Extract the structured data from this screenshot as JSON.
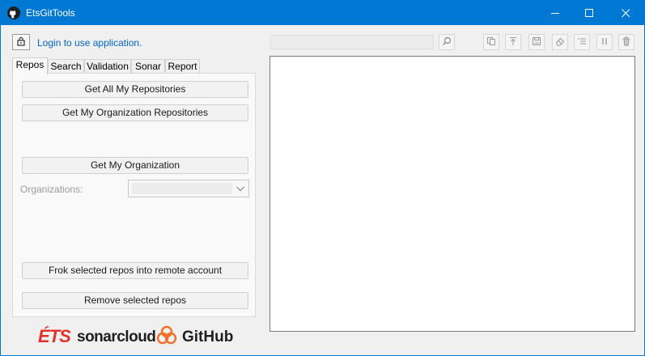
{
  "window": {
    "title": "EtsGitTools",
    "accent": "#0078d4"
  },
  "login": {
    "link_text": "Login to use application.",
    "icon": "lock-icon"
  },
  "tabs": [
    {
      "label": "Repos",
      "active": true
    },
    {
      "label": "Search",
      "active": false
    },
    {
      "label": "Validation",
      "active": false
    },
    {
      "label": "Sonar",
      "active": false
    },
    {
      "label": "Report",
      "active": false
    }
  ],
  "repos_tab": {
    "get_all_repos": "Get All My Repositories",
    "get_org_repos": "Get My Organization Repositories",
    "get_org": "Get My Organization",
    "organizations_label": "Organizations:",
    "organizations_value": "",
    "fork_repos": "Frok selected repos into remote account",
    "remove_repos": "Remove selected repos"
  },
  "logos": {
    "ets": "ÉTS",
    "sonarcloud": "sonarcloud",
    "github": "GitHub"
  },
  "toolbar": {
    "search_value": "",
    "icons": [
      "search-icon",
      "copy-icon",
      "upload-icon",
      "save-icon",
      "eraser-icon",
      "list-icon",
      "pause-icon",
      "trash-icon"
    ]
  },
  "output": {
    "text": ""
  }
}
